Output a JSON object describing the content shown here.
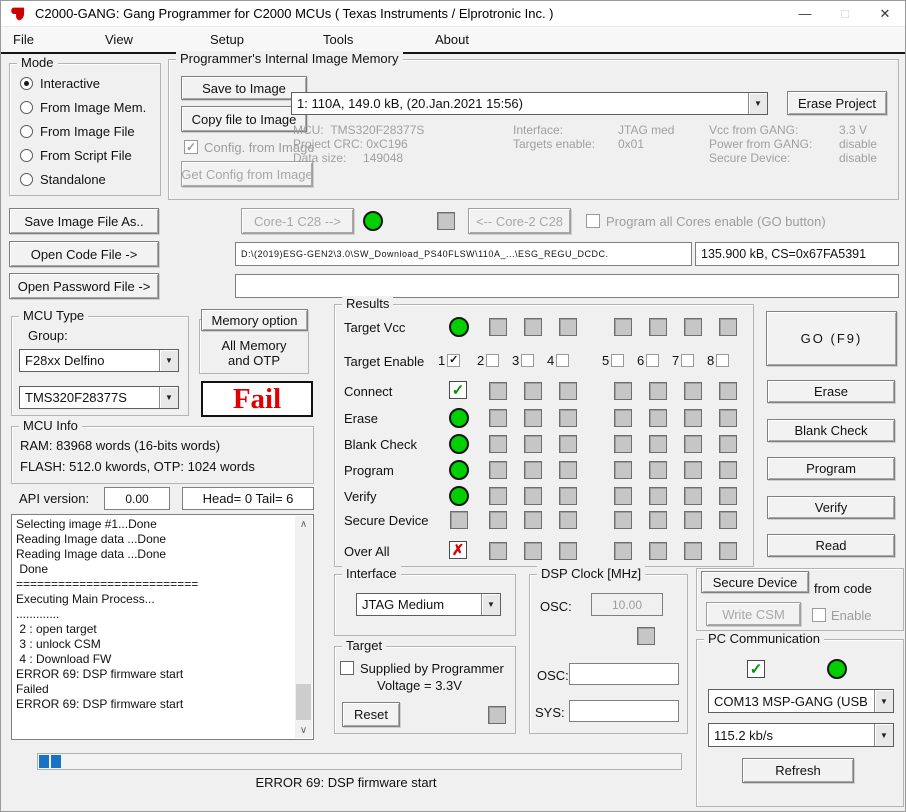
{
  "titlebar": {
    "title": "C2000-GANG:  Gang Programmer for C2000  MCUs ( Texas Instruments / Elprotronic Inc. )",
    "minimize": "—",
    "maximize": "□",
    "close": "✕",
    "app_icon": "ti-logo-red"
  },
  "menubar": {
    "items": [
      "File",
      "View",
      "Setup",
      "Tools",
      "About"
    ]
  },
  "mode": {
    "legend": "Mode",
    "options": [
      "Interactive",
      "From Image Mem.",
      "From Image File",
      "From Script File",
      "Standalone"
    ],
    "selected": "Interactive"
  },
  "image_memory": {
    "legend": "Programmer's Internal Image Memory",
    "save_to_image": "Save to Image",
    "copy_file_to_image": "Copy file to Image",
    "config_from_image": "Config. from Image",
    "config_from_image_checked": true,
    "get_config": "Get Config from Image",
    "slot_value": "1: 110A, 149.0 kB,  (20.Jan.2021  15:56)",
    "erase_project": "Erase Project",
    "info": {
      "mcu_label": "MCU:",
      "mcu": "TMS320F28377S",
      "crc_label": "Project CRC:",
      "crc": "0xC196",
      "size_label": "Data size:",
      "size": "149048",
      "iface_label": "Interface:",
      "iface": "JTAG med",
      "targets_label": "Targets enable:",
      "targets": "0x01",
      "vcc_label": "Vcc from GANG:",
      "vcc": "3.3 V",
      "power_label": "Power from GANG:",
      "power": "disable",
      "secure_label": "Secure Device:",
      "secure": "disable"
    }
  },
  "file_section": {
    "save_image_as": "Save Image File As..",
    "core1": "Core-1 C28 -->",
    "core2": "<-- Core-2 C28",
    "program_all_cores": "Program all Cores enable (GO button)",
    "open_code": "Open Code File ->",
    "code_path": "D:\\(2019)ESG-GEN2\\3.0\\SW_Download_PS40FLSW\\110A_...\\ESG_REGU_DCDC.",
    "code_size": "135.900 kB, CS=0x67FA5391",
    "open_password": "Open Password File ->",
    "password_path": ""
  },
  "mcu_type": {
    "legend": "MCU Type",
    "group_label": "Group:",
    "group_value": "F28xx Delfino",
    "device_value": "TMS320F28377S"
  },
  "memory_option": {
    "button_label": "Memory option",
    "detail": "All Memory\nand OTP"
  },
  "status_badge": {
    "text": "Fail",
    "color": "#e00000"
  },
  "mcu_info": {
    "legend": "MCU Info",
    "line1": "RAM: 83968 words (16-bits words)",
    "line2": "FLASH: 512.0 kwords,  OTP: 1024 words"
  },
  "api": {
    "label": "API version:",
    "value": "0.00",
    "head_tail": "Head= 0  Tail= 6"
  },
  "log": {
    "text": "Selecting image #1...Done\nReading Image data ...Done\nReading Image data ...Done\n Done\n==========================\nExecuting Main Process...\n.............\n 2 : open target\n 3 : unlock CSM\n 4 : Download FW\nERROR 69: DSP firmware start\nFailed\nERROR 69: DSP firmware start"
  },
  "results": {
    "legend": "Results",
    "enable_numbers": [
      "1",
      "2",
      "3",
      "4",
      "5",
      "6",
      "7",
      "8"
    ],
    "enable_checked": [
      1
    ],
    "rows": [
      {
        "label": "Target Vcc",
        "indicator": "green-led"
      },
      {
        "label": "Target Enable",
        "indicator": "checkboxes"
      },
      {
        "label": "Connect",
        "indicator": "green-check"
      },
      {
        "label": "Erase",
        "indicator": "green-led"
      },
      {
        "label": "Blank Check",
        "indicator": "green-led"
      },
      {
        "label": "Program",
        "indicator": "green-led"
      },
      {
        "label": "Verify",
        "indicator": "green-led"
      },
      {
        "label": "Secure Device",
        "indicator": "gray-square"
      },
      {
        "label": "Over All",
        "indicator": "red-x"
      }
    ]
  },
  "actions": {
    "go": "GO   (F9)",
    "erase": "Erase",
    "blank_check": "Blank Check",
    "program": "Program",
    "verify": "Verify",
    "read": "Read"
  },
  "interface_group": {
    "legend": "Interface",
    "value": "JTAG Medium"
  },
  "target_group": {
    "legend": "Target",
    "checkbox": "Supplied by Programmer",
    "voltage": "Voltage = 3.3V",
    "reset": "Reset"
  },
  "dsp_clock": {
    "legend": "DSP Clock [MHz]",
    "osc1_label": "OSC:",
    "osc1_value": "10.00",
    "osc2_label": "OSC:",
    "osc2_value": "",
    "sys_label": "SYS:",
    "sys_value": ""
  },
  "secure_section": {
    "secure_device": "Secure Device",
    "from_code": "from code",
    "write_csm": "Write CSM",
    "enable": "Enable"
  },
  "pc_comm": {
    "legend": "PC Communication",
    "port": "COM13   MSP-GANG (USB",
    "baud": "115.2 kb/s",
    "refresh": "Refresh"
  },
  "progress": {
    "status": "ERROR 69: DSP firmware start"
  },
  "colors": {
    "led_green": "#00d000",
    "fail_red": "#e00000",
    "progress_blue": "#1673c6",
    "title_bg": "#ffffff"
  }
}
